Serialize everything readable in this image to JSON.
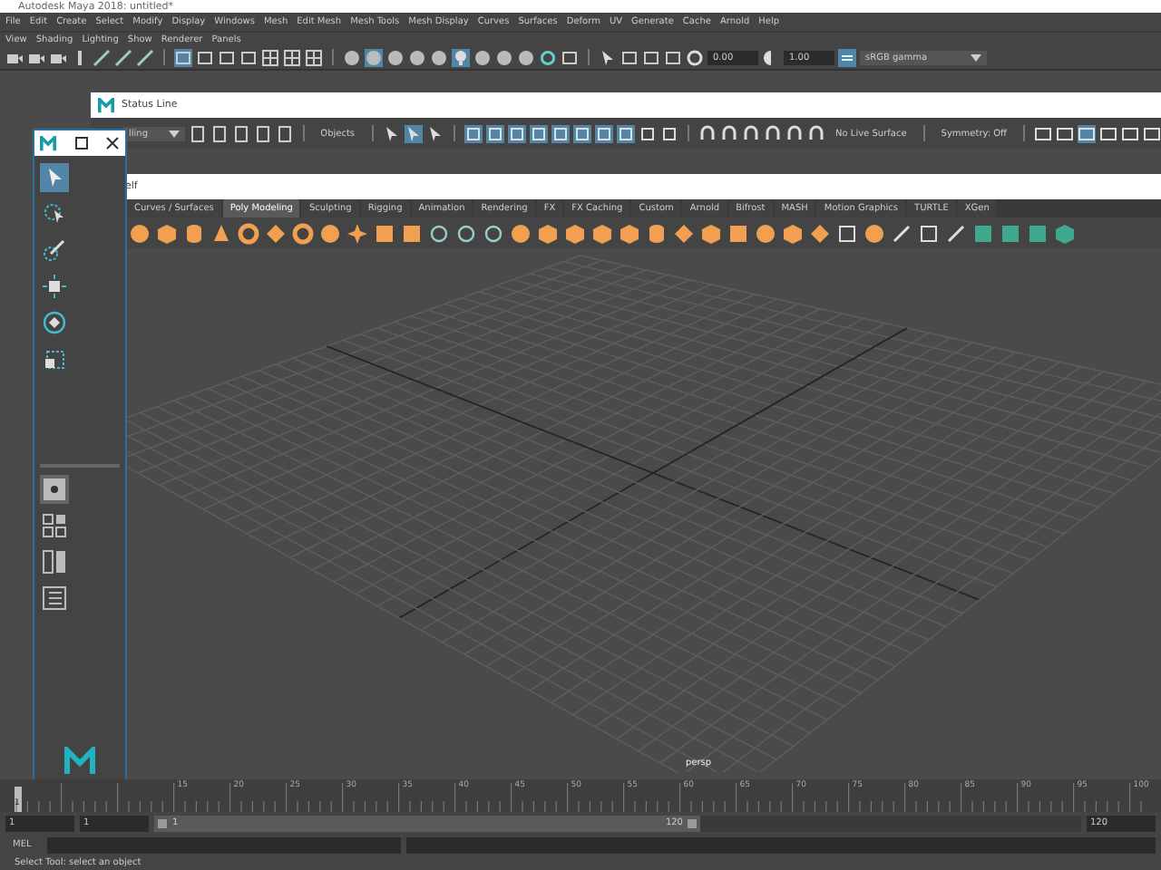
{
  "window": {
    "title": "Autodesk Maya 2018: untitled*"
  },
  "menu_bar": [
    "File",
    "Edit",
    "Create",
    "Select",
    "Modify",
    "Display",
    "Windows",
    "Mesh",
    "Edit Mesh",
    "Mesh Tools",
    "Mesh Display",
    "Curves",
    "Surfaces",
    "Deform",
    "UV",
    "Generate",
    "Cache",
    "Arnold",
    "Help"
  ],
  "panel_menu": [
    "View",
    "Shading",
    "Lighting",
    "Show",
    "Renderer",
    "Panels"
  ],
  "panel_toolbar": {
    "exposure": "0.00",
    "gamma": "1.00",
    "color_space": "sRGB gamma"
  },
  "status_line": {
    "title": "Status Line",
    "menu_set": "lling",
    "selection_mode": "Objects",
    "live_surface": "No Live Surface",
    "symmetry": "Symmetry: Off"
  },
  "shelf": {
    "title": "elf",
    "tabs": [
      {
        "label": "Curves / Surfaces",
        "selected": false
      },
      {
        "label": "Poly Modeling",
        "selected": true
      },
      {
        "label": "Sculpting",
        "selected": false
      },
      {
        "label": "Rigging",
        "selected": false
      },
      {
        "label": "Animation",
        "selected": false
      },
      {
        "label": "Rendering",
        "selected": false
      },
      {
        "label": "FX",
        "selected": false
      },
      {
        "label": "FX Caching",
        "selected": false
      },
      {
        "label": "Custom",
        "selected": false
      },
      {
        "label": "Arnold",
        "selected": false
      },
      {
        "label": "Bifrost",
        "selected": false
      },
      {
        "label": "MASH",
        "selected": false
      },
      {
        "label": "Motion Graphics",
        "selected": false
      },
      {
        "label": "TURTLE",
        "selected": false
      },
      {
        "label": "XGen",
        "selected": false
      }
    ]
  },
  "toolbox": {
    "tools": [
      {
        "kind": "select",
        "selected": true
      },
      {
        "kind": "lasso",
        "selected": false
      },
      {
        "kind": "paint",
        "selected": false
      },
      {
        "kind": "move",
        "selected": false
      },
      {
        "kind": "rotate",
        "selected": false
      },
      {
        "kind": "scale",
        "selected": false
      }
    ]
  },
  "viewport": {
    "camera": "persp"
  },
  "time_slider": {
    "current_frame": "1",
    "level": 0,
    "tick_labels": [
      "15",
      "20",
      "25",
      "30",
      "35",
      "40",
      "45",
      "50",
      "55",
      "60",
      "65",
      "70",
      "75",
      "80",
      "85",
      "90",
      "95",
      "100"
    ]
  },
  "range_slider": {
    "level": 0.59,
    "start": "1",
    "playback_start": "1",
    "slider_start": "1",
    "slider_end": "120",
    "end": "120"
  },
  "command_line": {
    "language": "MEL"
  },
  "help_line": "Select Tool: select an object"
}
